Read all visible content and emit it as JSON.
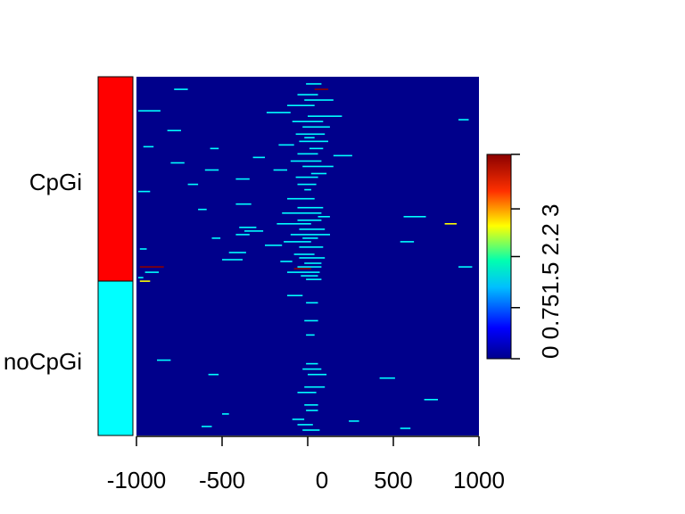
{
  "chart_data": {
    "type": "heatmap",
    "x_ticks": [
      -1000,
      -500,
      0,
      500,
      1000
    ],
    "x_tick_labels": [
      "-1000",
      "-500",
      "0",
      "500",
      "1000"
    ],
    "xlim": [
      -1000,
      1000
    ],
    "background_value": 0,
    "row_groups": [
      {
        "label": "CpGi",
        "color": "#ff0000",
        "row_fraction": 0.57
      },
      {
        "label": "noCpGi",
        "color": "#00ffff",
        "row_fraction": 0.43
      }
    ],
    "segments": [
      {
        "x": [
          -780,
          -700
        ],
        "row": 0.035,
        "v": 0.7
      },
      {
        "x": [
          -10,
          80
        ],
        "row": 0.02,
        "v": 0.7
      },
      {
        "x": [
          40,
          120
        ],
        "row": 0.035,
        "v": 2.8
      },
      {
        "x": [
          -60,
          60
        ],
        "row": 0.05,
        "v": 0.7
      },
      {
        "x": [
          -20,
          150
        ],
        "row": 0.065,
        "v": 0.7
      },
      {
        "x": [
          -120,
          40
        ],
        "row": 0.08,
        "v": 0.7
      },
      {
        "x": [
          -990,
          -860
        ],
        "row": 0.095,
        "v": 0.7
      },
      {
        "x": [
          -240,
          -100
        ],
        "row": 0.1,
        "v": 0.7
      },
      {
        "x": [
          0,
          200
        ],
        "row": 0.11,
        "v": 0.7
      },
      {
        "x": [
          -90,
          90
        ],
        "row": 0.125,
        "v": 0.7
      },
      {
        "x": [
          880,
          940
        ],
        "row": 0.12,
        "v": 0.7
      },
      {
        "x": [
          -30,
          130
        ],
        "row": 0.14,
        "v": 0.7
      },
      {
        "x": [
          -820,
          -740
        ],
        "row": 0.15,
        "v": 0.7
      },
      {
        "x": [
          -70,
          100
        ],
        "row": 0.16,
        "v": 0.7
      },
      {
        "x": [
          -20,
          40
        ],
        "row": 0.17,
        "v": 0.7
      },
      {
        "x": [
          -50,
          120
        ],
        "row": 0.18,
        "v": 0.7
      },
      {
        "x": [
          -170,
          -80
        ],
        "row": 0.19,
        "v": 0.7
      },
      {
        "x": [
          -960,
          -900
        ],
        "row": 0.195,
        "v": 0.7
      },
      {
        "x": [
          10,
          90
        ],
        "row": 0.2,
        "v": 0.7
      },
      {
        "x": [
          -570,
          -520
        ],
        "row": 0.2,
        "v": 0.7
      },
      {
        "x": [
          -60,
          60
        ],
        "row": 0.215,
        "v": 0.7
      },
      {
        "x": [
          150,
          260
        ],
        "row": 0.22,
        "v": 0.7
      },
      {
        "x": [
          -320,
          -250
        ],
        "row": 0.225,
        "v": 0.7
      },
      {
        "x": [
          -100,
          80
        ],
        "row": 0.235,
        "v": 0.7
      },
      {
        "x": [
          -800,
          -720
        ],
        "row": 0.24,
        "v": 0.7
      },
      {
        "x": [
          -30,
          150
        ],
        "row": 0.25,
        "v": 0.7
      },
      {
        "x": [
          -200,
          -120
        ],
        "row": 0.26,
        "v": 0.7
      },
      {
        "x": [
          -600,
          -520
        ],
        "row": 0.26,
        "v": 0.7
      },
      {
        "x": [
          20,
          110
        ],
        "row": 0.27,
        "v": 0.7
      },
      {
        "x": [
          -70,
          60
        ],
        "row": 0.28,
        "v": 0.7
      },
      {
        "x": [
          -420,
          -340
        ],
        "row": 0.285,
        "v": 0.7
      },
      {
        "x": [
          -60,
          50
        ],
        "row": 0.3,
        "v": 0.7
      },
      {
        "x": [
          -700,
          -640
        ],
        "row": 0.3,
        "v": 0.7
      },
      {
        "x": [
          -20,
          20
        ],
        "row": 0.315,
        "v": 0.7
      },
      {
        "x": [
          -990,
          -920
        ],
        "row": 0.32,
        "v": 0.7
      },
      {
        "x": [
          -120,
          40
        ],
        "row": 0.34,
        "v": 0.7
      },
      {
        "x": [
          -420,
          -330
        ],
        "row": 0.355,
        "v": 0.7
      },
      {
        "x": [
          -60,
          90
        ],
        "row": 0.365,
        "v": 0.7
      },
      {
        "x": [
          -640,
          -590
        ],
        "row": 0.37,
        "v": 0.7
      },
      {
        "x": [
          -150,
          80
        ],
        "row": 0.38,
        "v": 0.7
      },
      {
        "x": [
          60,
          130
        ],
        "row": 0.39,
        "v": 0.7
      },
      {
        "x": [
          -60,
          80
        ],
        "row": 0.4,
        "v": 0.7
      },
      {
        "x": [
          560,
          690
        ],
        "row": 0.39,
        "v": 0.7
      },
      {
        "x": [
          -180,
          20
        ],
        "row": 0.41,
        "v": 0.7
      },
      {
        "x": [
          -400,
          -300
        ],
        "row": 0.42,
        "v": 0.7
      },
      {
        "x": [
          -50,
          100
        ],
        "row": 0.425,
        "v": 0.7
      },
      {
        "x": [
          800,
          870
        ],
        "row": 0.41,
        "v": 2.2
      },
      {
        "x": [
          -370,
          -260
        ],
        "row": 0.43,
        "v": 0.7
      },
      {
        "x": [
          -100,
          130
        ],
        "row": 0.44,
        "v": 0.7
      },
      {
        "x": [
          -420,
          -340
        ],
        "row": 0.44,
        "v": 0.7
      },
      {
        "x": [
          -30,
          60
        ],
        "row": 0.45,
        "v": 0.7
      },
      {
        "x": [
          -560,
          -510
        ],
        "row": 0.45,
        "v": 0.7
      },
      {
        "x": [
          -140,
          20
        ],
        "row": 0.46,
        "v": 0.7
      },
      {
        "x": [
          -250,
          -150
        ],
        "row": 0.47,
        "v": 0.7
      },
      {
        "x": [
          -50,
          90
        ],
        "row": 0.475,
        "v": 0.7
      },
      {
        "x": [
          540,
          620
        ],
        "row": 0.46,
        "v": 0.7
      },
      {
        "x": [
          -980,
          -940
        ],
        "row": 0.48,
        "v": 0.7
      },
      {
        "x": [
          -460,
          -360
        ],
        "row": 0.49,
        "v": 0.7
      },
      {
        "x": [
          -80,
          40
        ],
        "row": 0.495,
        "v": 0.7
      },
      {
        "x": [
          -50,
          100
        ],
        "row": 0.505,
        "v": 0.7
      },
      {
        "x": [
          -500,
          -380
        ],
        "row": 0.51,
        "v": 0.7
      },
      {
        "x": [
          -160,
          -90
        ],
        "row": 0.515,
        "v": 0.7
      },
      {
        "x": [
          -20,
          80
        ],
        "row": 0.52,
        "v": 0.7
      },
      {
        "x": [
          880,
          960
        ],
        "row": 0.53,
        "v": 0.7
      },
      {
        "x": [
          -980,
          -840
        ],
        "row": 0.53,
        "v": 2.8
      },
      {
        "x": [
          -60,
          80
        ],
        "row": 0.53,
        "v": 0.7
      },
      {
        "x": [
          -80,
          20
        ],
        "row": 0.535,
        "v": 2.8
      },
      {
        "x": [
          -120,
          70
        ],
        "row": 0.545,
        "v": 0.7
      },
      {
        "x": [
          -950,
          -870
        ],
        "row": 0.545,
        "v": 0.7
      },
      {
        "x": [
          -980,
          -920
        ],
        "row": 0.57,
        "v": 2.2
      },
      {
        "x": [
          -40,
          60
        ],
        "row": 0.555,
        "v": 0.7
      },
      {
        "x": [
          -10,
          80
        ],
        "row": 0.565,
        "v": 0.7
      },
      {
        "x": [
          -990,
          -960
        ],
        "row": 0.56,
        "v": 0.7
      },
      {
        "x": [
          -120,
          -30
        ],
        "row": 0.61,
        "v": 0.7
      },
      {
        "x": [
          -10,
          60
        ],
        "row": 0.63,
        "v": 0.7
      },
      {
        "x": [
          -20,
          60
        ],
        "row": 0.68,
        "v": 0.7
      },
      {
        "x": [
          -10,
          40
        ],
        "row": 0.72,
        "v": 0.7
      },
      {
        "x": [
          -880,
          -800
        ],
        "row": 0.79,
        "v": 0.7
      },
      {
        "x": [
          -10,
          60
        ],
        "row": 0.8,
        "v": 0.7
      },
      {
        "x": [
          -30,
          80
        ],
        "row": 0.815,
        "v": 0.7
      },
      {
        "x": [
          -580,
          -520
        ],
        "row": 0.83,
        "v": 0.7
      },
      {
        "x": [
          0,
          110
        ],
        "row": 0.83,
        "v": 0.7
      },
      {
        "x": [
          420,
          510
        ],
        "row": 0.84,
        "v": 0.7
      },
      {
        "x": [
          -20,
          100
        ],
        "row": 0.865,
        "v": 0.7
      },
      {
        "x": [
          -60,
          50
        ],
        "row": 0.88,
        "v": 0.7
      },
      {
        "x": [
          680,
          760
        ],
        "row": 0.9,
        "v": 0.7
      },
      {
        "x": [
          -20,
          60
        ],
        "row": 0.915,
        "v": 0.7
      },
      {
        "x": [
          -10,
          60
        ],
        "row": 0.93,
        "v": 0.7
      },
      {
        "x": [
          -500,
          -460
        ],
        "row": 0.94,
        "v": 0.7
      },
      {
        "x": [
          -90,
          -20
        ],
        "row": 0.955,
        "v": 0.7
      },
      {
        "x": [
          -60,
          30
        ],
        "row": 0.97,
        "v": 0.7
      },
      {
        "x": [
          240,
          300
        ],
        "row": 0.96,
        "v": 0.7
      },
      {
        "x": [
          -620,
          -560
        ],
        "row": 0.975,
        "v": 0.7
      },
      {
        "x": [
          540,
          600
        ],
        "row": 0.98,
        "v": 0.7
      },
      {
        "x": [
          -30,
          70
        ],
        "row": 0.985,
        "v": 0.7
      }
    ],
    "colorbar": {
      "min": 0,
      "max": 3,
      "ticks": [
        0,
        0.75,
        1.5,
        2.2,
        3
      ],
      "tick_labels": [
        "0",
        "0.75",
        "1.5",
        "2.2",
        "3"
      ],
      "tick_label_text": "0 0.751.5 2.2 3"
    },
    "colors": {
      "low": "#00008b",
      "mid_low": "#0000ff",
      "cyan": "#00ffff",
      "yellow": "#ffff00",
      "red": "#ff0000",
      "high": "#8b0000"
    }
  }
}
